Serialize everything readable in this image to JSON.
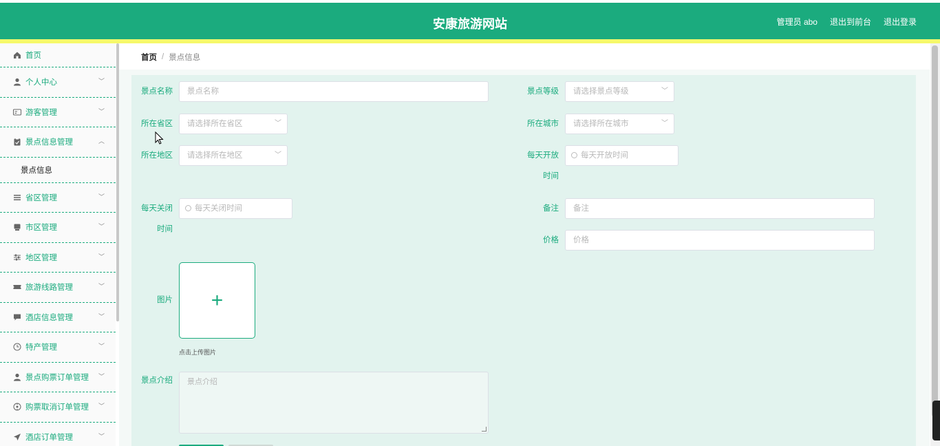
{
  "header": {
    "title": "安康旅游网站",
    "admin": "管理员 abo",
    "front_link": "退出到前台",
    "logout": "退出登录"
  },
  "sidebar": {
    "items": [
      {
        "label": "首页",
        "icon": "home-icon"
      },
      {
        "label": "个人中心",
        "icon": "user-icon"
      },
      {
        "label": "游客管理",
        "icon": "id-card-icon"
      },
      {
        "label": "景点信息管理",
        "icon": "clipboard-icon",
        "expanded": true
      },
      {
        "label": "景点信息",
        "sub": true
      },
      {
        "label": "省区管理",
        "icon": "list-icon"
      },
      {
        "label": "市区管理",
        "icon": "desk-icon"
      },
      {
        "label": "地区管理",
        "icon": "sliders-icon"
      },
      {
        "label": "旅游线路管理",
        "icon": "ticket-icon"
      },
      {
        "label": "酒店信息管理",
        "icon": "chat-icon"
      },
      {
        "label": "特产管理",
        "icon": "clock-icon"
      },
      {
        "label": "景点购票订单管理",
        "icon": "user-icon"
      },
      {
        "label": "购票取消订单管理",
        "icon": "compass-icon"
      },
      {
        "label": "酒店订单管理",
        "icon": "send-icon"
      }
    ]
  },
  "breadcrumb": {
    "home": "首页",
    "separator": "/",
    "current": "景点信息"
  },
  "form": {
    "name_label": "景点名称",
    "name_placeholder": "景点名称",
    "level_label": "景点等级",
    "level_placeholder": "请选择景点等级",
    "province_label": "所在省区",
    "province_placeholder": "请选择所在省区",
    "city_label": "所在城市",
    "city_placeholder": "请选择所在城市",
    "region_label": "所在地区",
    "region_placeholder": "请选择所在地区",
    "open_label_1": "每天开放",
    "open_label_2": "时间",
    "open_placeholder": "每天开放时间",
    "close_label_1": "每天关闭",
    "close_label_2": "时间",
    "close_placeholder": "每天关闭时间",
    "remark_label": "备注",
    "remark_placeholder": "备注",
    "price_label": "价格",
    "price_placeholder": "价格",
    "image_label": "图片",
    "upload_plus": "+",
    "upload_tip": "点击上传图片",
    "intro_label": "景点介绍",
    "intro_placeholder": "景点介绍"
  },
  "colors": {
    "primary": "#1bab7e",
    "accent_bar": "#f6f96a",
    "panel_bg": "#e2f3ee"
  }
}
